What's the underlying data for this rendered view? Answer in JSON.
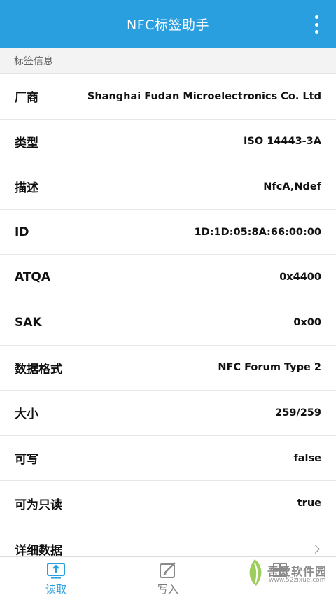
{
  "app_bar": {
    "title": "NFC标签助手",
    "more_icon": "more-vert-icon"
  },
  "section": {
    "header": "标签信息"
  },
  "rows": [
    {
      "label": "厂商",
      "value": "Shanghai Fudan Microelectronics Co. Ltd"
    },
    {
      "label": "类型",
      "value": "ISO 14443-3A"
    },
    {
      "label": "描述",
      "value": "NfcA,Ndef"
    },
    {
      "label": "ID",
      "value": "1D:1D:05:8A:66:00:00"
    },
    {
      "label": "ATQA",
      "value": "0x4400"
    },
    {
      "label": "SAK",
      "value": "0x00"
    },
    {
      "label": "数据格式",
      "value": "NFC Forum Type 2"
    },
    {
      "label": "大小",
      "value": "259/259"
    },
    {
      "label": "可写",
      "value": "false"
    },
    {
      "label": "可为只读",
      "value": "true"
    }
  ],
  "detail_row": {
    "label": "详细数据",
    "icon": "chevron-right-icon"
  },
  "bottom_nav": {
    "items": [
      {
        "label": "读取",
        "icon": "read-tag-icon",
        "active": true
      },
      {
        "label": "写入",
        "icon": "edit-icon",
        "active": false
      },
      {
        "label": "",
        "icon": "grid-icon",
        "active": false
      }
    ]
  },
  "watermark": {
    "text": "吾爱软件园",
    "url": "www.52zixue.com"
  },
  "colors": {
    "primary": "#2a9fe0",
    "section_bg": "#f3f3f3",
    "divider": "#e6e6e6",
    "text": "#111111",
    "inactive": "#7a7a7a"
  }
}
